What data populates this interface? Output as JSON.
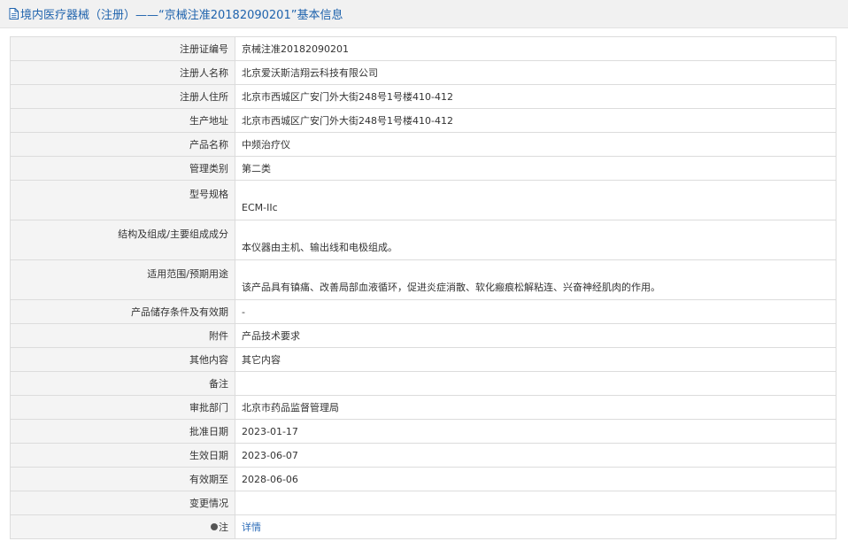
{
  "header": {
    "icon": "document-icon",
    "title": "境内医疗器械（注册）——“京械注准20182090201”基本信息"
  },
  "rows": [
    {
      "label": "注册证编号",
      "value": "京械注准20182090201"
    },
    {
      "label": "注册人名称",
      "value": "北京爱沃斯洁翔云科技有限公司"
    },
    {
      "label": "注册人住所",
      "value": "北京市西城区广安门外大街248号1号楼410-412"
    },
    {
      "label": "生产地址",
      "value": "北京市西城区广安门外大街248号1号楼410-412"
    },
    {
      "label": "产品名称",
      "value": "中频治疗仪"
    },
    {
      "label": "管理类别",
      "value": "第二类"
    },
    {
      "label": "型号规格",
      "value": "ECM-IIc"
    },
    {
      "label": "结构及组成/主要组成成分",
      "value": "本仪器由主机、输出线和电极组成。"
    },
    {
      "label": "适用范围/预期用途",
      "value": "该产品具有镇痛、改善局部血液循环，促进炎症消散、软化瘢痕松解粘连、兴奋神经肌肉的作用。"
    },
    {
      "label": "产品储存条件及有效期",
      "value": "-"
    },
    {
      "label": "附件",
      "value": "产品技术要求"
    },
    {
      "label": "其他内容",
      "value": "其它内容"
    },
    {
      "label": "备注",
      "value": ""
    },
    {
      "label": "审批部门",
      "value": "北京市药品监督管理局"
    },
    {
      "label": "批准日期",
      "value": "2023-01-17"
    },
    {
      "label": "生效日期",
      "value": "2023-06-07"
    },
    {
      "label": "有效期至",
      "value": "2028-06-06"
    },
    {
      "label": "变更情况",
      "value": ""
    },
    {
      "label": "注",
      "value": "详情",
      "icon": "bullet-icon"
    }
  ],
  "colors": {
    "header_text": "#1f63ad",
    "header_bg": "#f1f1f1",
    "label_bg": "#f4f4f4",
    "border": "#dcdcdc",
    "link": "#2c6cb8"
  }
}
